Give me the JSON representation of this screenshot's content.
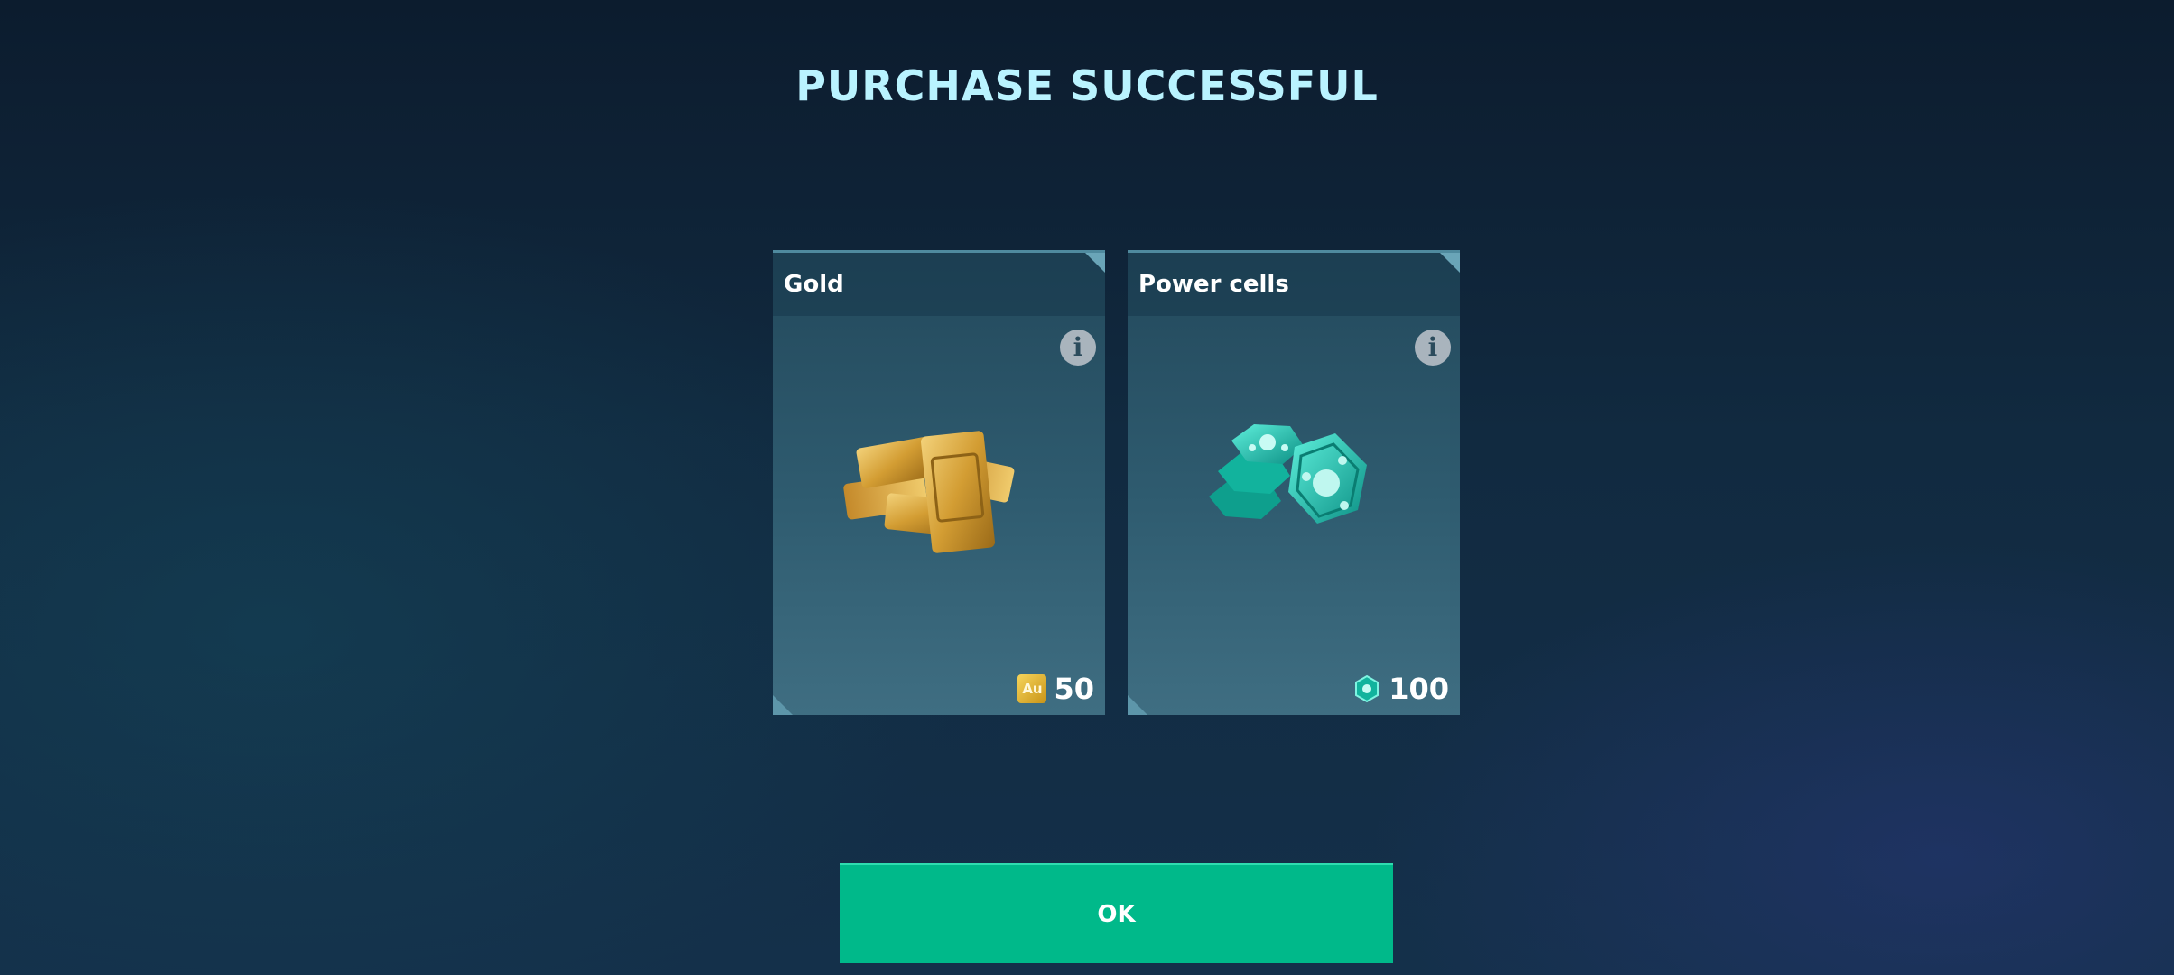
{
  "header": {
    "title": "PURCHASE SUCCESSFUL"
  },
  "rewards": [
    {
      "name": "Gold",
      "amount": "50",
      "currency_icon": "gold-bar-icon",
      "currency_label": "Au"
    },
    {
      "name": "Power cells",
      "amount": "100",
      "currency_icon": "power-cell-icon"
    }
  ],
  "info_label": "i",
  "ok_button": {
    "label": "OK"
  },
  "colors": {
    "title": "#b9f3ff",
    "ok_button": "#00b98a",
    "gold": "#d9a93a",
    "power_cell": "#19c9b0"
  }
}
